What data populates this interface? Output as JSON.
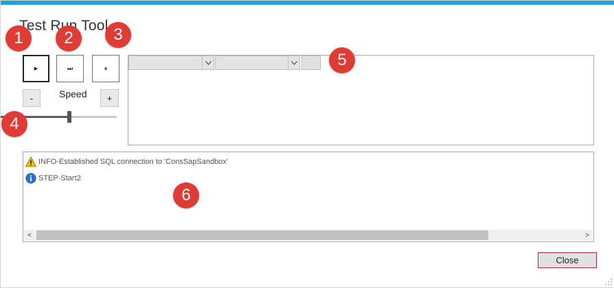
{
  "window": {
    "title": "Test Run Tool"
  },
  "controls": {
    "play_icon": "play-icon",
    "step_icon": "step-forward-icon",
    "pause_icon": "pause-icon",
    "play_glyph": "▶",
    "step_glyph": "⏭",
    "pause_glyph": "⏸"
  },
  "speed": {
    "label": "Speed",
    "minus_label": "-",
    "plus_label": "+",
    "level_fraction": 0.59
  },
  "toolbar5": {
    "combo1_value": "",
    "combo2_value": "",
    "button_label": ""
  },
  "log": {
    "entries": [
      {
        "type": "warning",
        "icon": "warning-icon",
        "text": "INFO-Established SQL connection to 'ConsSapSandbox'"
      },
      {
        "type": "info",
        "icon": "info-icon",
        "text": "STEP-Start2"
      }
    ],
    "scroll_left": "<",
    "scroll_right": ">"
  },
  "footer": {
    "close_label": "Close"
  },
  "badges": [
    "1",
    "2",
    "3",
    "4",
    "5",
    "6"
  ],
  "colors": {
    "accent_bar": "#1ca3db",
    "badge": "#e03b35",
    "close_border": "#a8244a"
  }
}
